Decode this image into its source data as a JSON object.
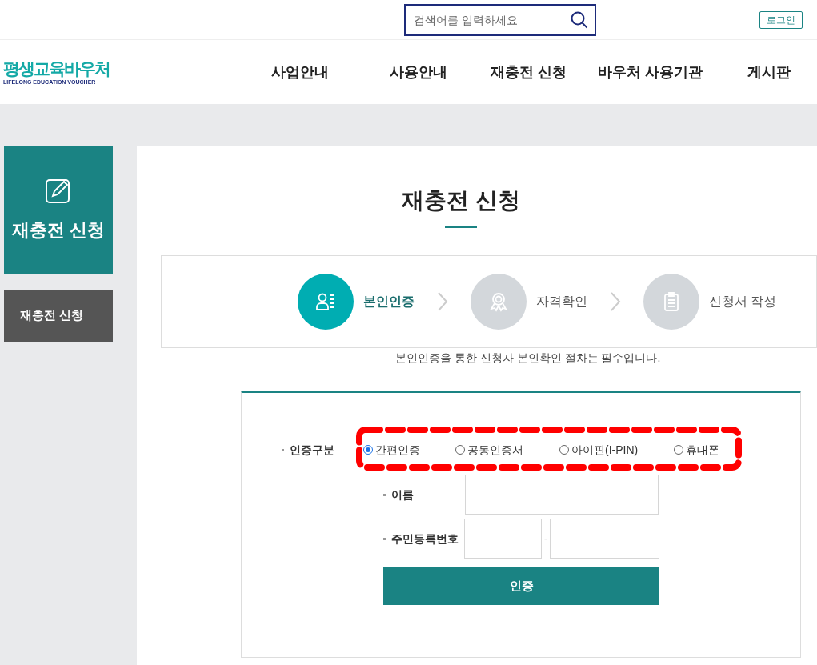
{
  "search": {
    "placeholder": "검색어를 입력하세요"
  },
  "login": "로그인",
  "logo": {
    "title": "평생교육바우처",
    "subtitle": "LIFELONG EDUCATION VOUCHER"
  },
  "nav": [
    "사업안내",
    "사용안내",
    "재충전 신청",
    "바우처 사용기관",
    "게시판"
  ],
  "sidebar": {
    "title": "재충전 신청",
    "items": [
      {
        "label": "재충전 신청",
        "selected": true
      }
    ]
  },
  "page_title": "재충전 신청",
  "steps": [
    {
      "label": "본인인증",
      "selected": true
    },
    {
      "label": "자격확인",
      "selected": false
    },
    {
      "label": "신청서 작성",
      "selected": false
    }
  ],
  "notice": "본인인증을 통한 신청자 본인확인 절차는 필수입니다.",
  "form": {
    "auth_type": {
      "label": "인증구분",
      "highlighted": true,
      "options": [
        {
          "label": "간편인증",
          "selected": true
        },
        {
          "label": "공동인증서",
          "selected": false
        },
        {
          "label": "아이핀(I-PIN)",
          "selected": false
        },
        {
          "label": "휴대폰",
          "selected": false
        }
      ]
    },
    "name": {
      "label": "이름"
    },
    "rrn": {
      "label": "주민등록번호",
      "separator": "-"
    },
    "submit": "인증"
  }
}
